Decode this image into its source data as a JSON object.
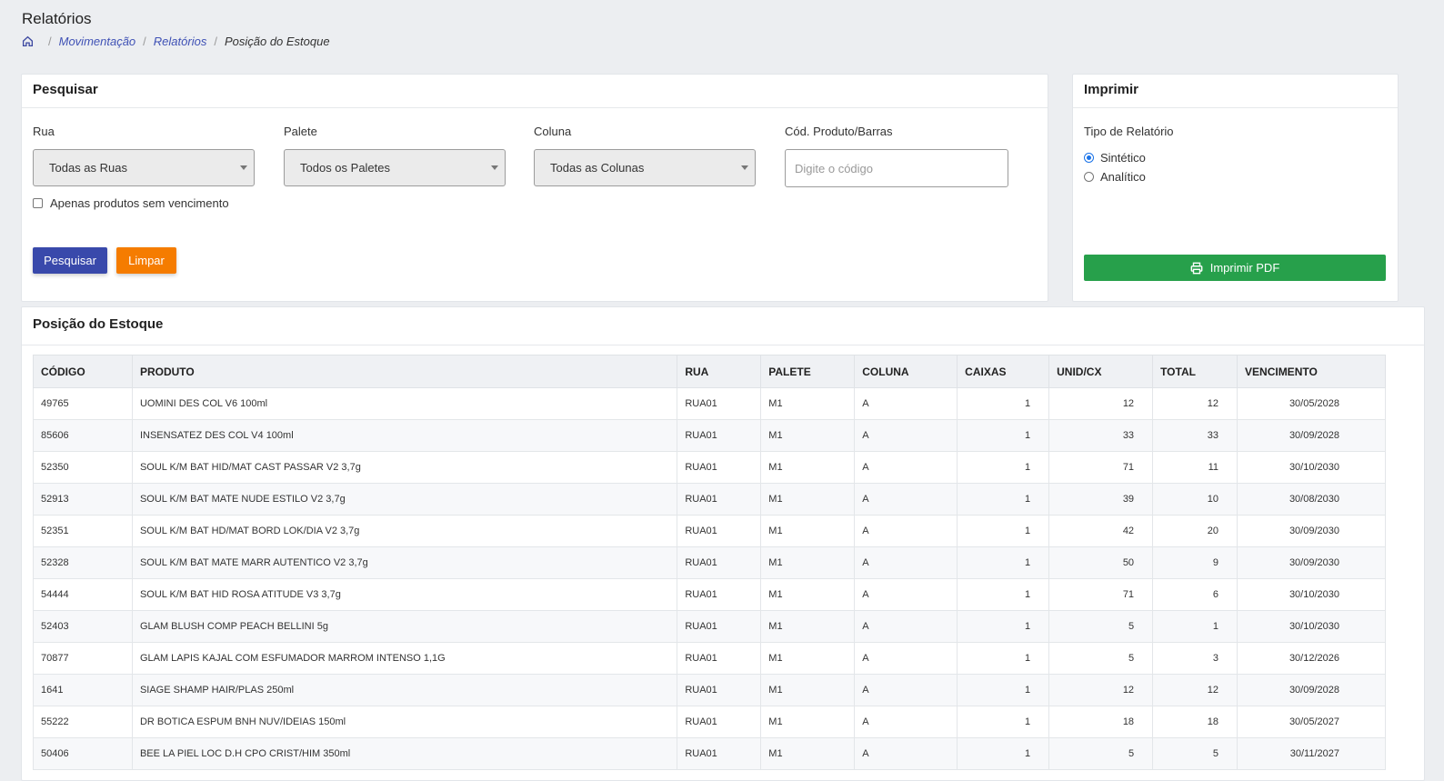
{
  "page": {
    "title": "Relatórios"
  },
  "breadcrumb": {
    "home_icon": "home-icon",
    "items": [
      "Movimentação",
      "Relatórios",
      "Posição do Estoque"
    ]
  },
  "search": {
    "title": "Pesquisar",
    "rua": {
      "label": "Rua",
      "value": "Todas as Ruas"
    },
    "palete": {
      "label": "Palete",
      "value": "Todos os Paletes"
    },
    "coluna": {
      "label": "Coluna",
      "value": "Todas as Colunas"
    },
    "codigo": {
      "label": "Cód. Produto/Barras",
      "placeholder": "Digite o código",
      "value": ""
    },
    "checkbox_label": "Apenas produtos sem vencimento",
    "checkbox_checked": false,
    "search_button": "Pesquisar",
    "clear_button": "Limpar"
  },
  "print": {
    "title": "Imprimir",
    "report_type_label": "Tipo de Relatório",
    "options": [
      {
        "label": "Sintético",
        "checked": true
      },
      {
        "label": "Analítico",
        "checked": false
      }
    ],
    "button": "Imprimir PDF"
  },
  "stock": {
    "title": "Posição do Estoque",
    "columns": [
      "CÓDIGO",
      "PRODUTO",
      "RUA",
      "PALETE",
      "COLUNA",
      "CAIXAS",
      "UNID/CX",
      "TOTAL",
      "VENCIMENTO"
    ],
    "rows": [
      [
        "49765",
        "UOMINI DES COL V6 100ml",
        "RUA01",
        "M1",
        "A",
        "1",
        "12",
        "12",
        "30/05/2028"
      ],
      [
        "85606",
        "INSENSATEZ DES COL V4 100ml",
        "RUA01",
        "M1",
        "A",
        "1",
        "33",
        "33",
        "30/09/2028"
      ],
      [
        "52350",
        "SOUL K/M BAT HID/MAT CAST PASSAR V2 3,7g",
        "RUA01",
        "M1",
        "A",
        "1",
        "71",
        "11",
        "30/10/2030"
      ],
      [
        "52913",
        "SOUL K/M BAT MATE NUDE ESTILO V2 3,7g",
        "RUA01",
        "M1",
        "A",
        "1",
        "39",
        "10",
        "30/08/2030"
      ],
      [
        "52351",
        "SOUL K/M BAT HD/MAT BORD LOK/DIA V2 3,7g",
        "RUA01",
        "M1",
        "A",
        "1",
        "42",
        "20",
        "30/09/2030"
      ],
      [
        "52328",
        "SOUL K/M BAT MATE MARR AUTENTICO V2 3,7g",
        "RUA01",
        "M1",
        "A",
        "1",
        "50",
        "9",
        "30/09/2030"
      ],
      [
        "54444",
        "SOUL K/M BAT HID ROSA ATITUDE V3 3,7g",
        "RUA01",
        "M1",
        "A",
        "1",
        "71",
        "6",
        "30/10/2030"
      ],
      [
        "52403",
        "GLAM BLUSH COMP PEACH BELLINI 5g",
        "RUA01",
        "M1",
        "A",
        "1",
        "5",
        "1",
        "30/10/2030"
      ],
      [
        "70877",
        "GLAM LAPIS KAJAL COM ESFUMADOR MARROM INTENSO 1,1G",
        "RUA01",
        "M1",
        "A",
        "1",
        "5",
        "3",
        "30/12/2026"
      ],
      [
        "1641",
        "SIAGE SHAMP HAIR/PLAS 250ml",
        "RUA01",
        "M1",
        "A",
        "1",
        "12",
        "12",
        "30/09/2028"
      ],
      [
        "55222",
        "DR BOTICA ESPUM BNH NUV/IDEIAS 150ml",
        "RUA01",
        "M1",
        "A",
        "1",
        "18",
        "18",
        "30/05/2027"
      ],
      [
        "50406",
        "BEE LA PIEL LOC D.H CPO CRIST/HIM 350ml",
        "RUA01",
        "M1",
        "A",
        "1",
        "5",
        "5",
        "30/11/2027"
      ]
    ]
  },
  "colors": {
    "primary": "#3949ab",
    "warning": "#f57c00",
    "success": "#27a04b",
    "link": "#3f51b5"
  }
}
